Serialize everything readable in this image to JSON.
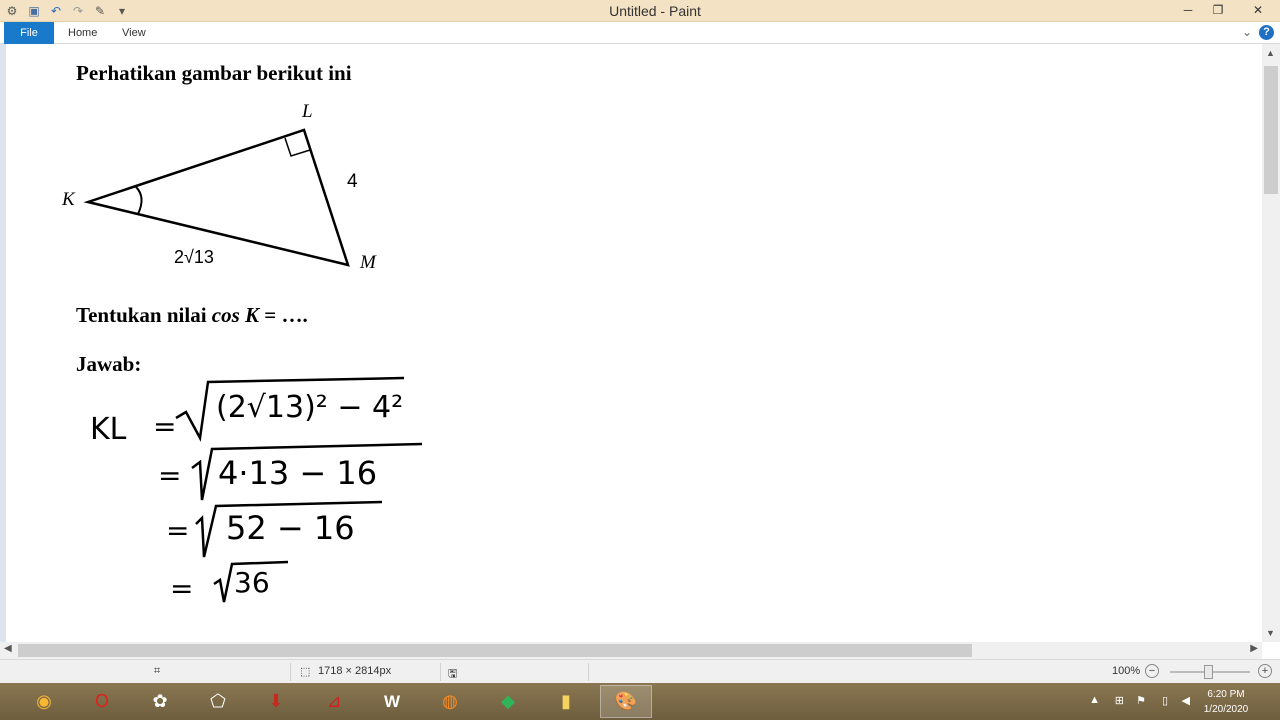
{
  "window": {
    "title": "Untitled - Paint",
    "qat_icons": [
      "paint-app-icon",
      "save-icon",
      "undo-icon",
      "redo-icon",
      "pencil-icon",
      "customize-qat-icon"
    ],
    "minimize": "─",
    "maximize": "❐",
    "close": "✕"
  },
  "ribbon": {
    "tabs": [
      "File",
      "Home",
      "View"
    ],
    "help": "?"
  },
  "document": {
    "heading": "Perhatikan gambar berikut ini",
    "figure": {
      "vertex_k": "K",
      "vertex_l": "L",
      "vertex_m": "M",
      "side_lm": "4",
      "side_km": "2√13"
    },
    "question_prefix": "Tentukan nilai ",
    "question_cos": "cos K",
    "question_suffix": " = ….",
    "answer_label": "Jawab:",
    "handwriting": {
      "line1_lhs": "KL",
      "line1_eq": "=",
      "line1_rad": "(2√13)² − 4²",
      "line2_eq": "=",
      "line2_rad": "4·13 − 16",
      "line3_eq": "=",
      "line3_rad": "52 − 16",
      "line4_eq": "=",
      "line4_rad": "36"
    }
  },
  "statusbar": {
    "dimensions": "1718 × 2814px",
    "zoom": "100%",
    "zoom_out": "−",
    "zoom_in": "+"
  },
  "taskbar": {
    "apps": [
      "start-orb-icon",
      "opera-icon",
      "paint-brush-app-icon",
      "geogebra-icon",
      "download-manager-icon",
      "pdf-reader-icon",
      "word-icon",
      "firefox-icon",
      "camtasia-icon",
      "file-explorer-icon",
      "paint-icon"
    ],
    "time": "6:20 PM",
    "date": "1/20/2020"
  }
}
